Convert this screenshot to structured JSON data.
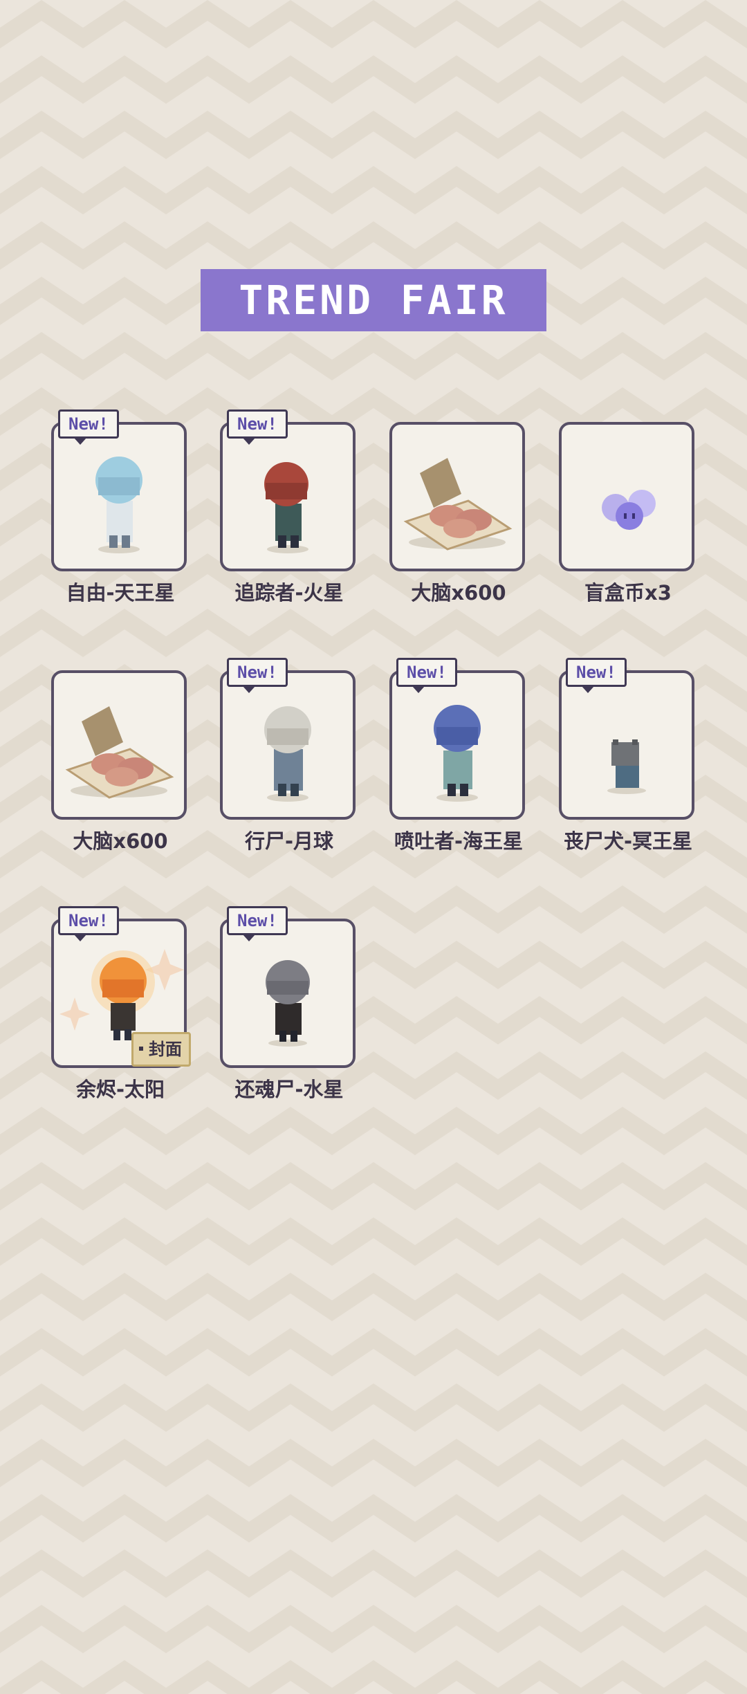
{
  "title": "TREND FAIR",
  "badge_text": "New!",
  "items": [
    {
      "label": "自由-天王星",
      "new": true,
      "art": "character-pale-blue-icon"
    },
    {
      "label": "追踪者-火星",
      "new": true,
      "art": "character-red-hair-icon"
    },
    {
      "label": "大脑x600",
      "new": false,
      "art": "brain-box-icon"
    },
    {
      "label": "盲盒币x3",
      "new": false,
      "art": "blind-box-coin-icon"
    },
    {
      "label": "大脑x600",
      "new": false,
      "art": "brain-box-icon"
    },
    {
      "label": "行尸-月球",
      "new": true,
      "art": "character-grey-hair-icon"
    },
    {
      "label": "喷吐者-海王星",
      "new": true,
      "art": "character-blue-hair-icon"
    },
    {
      "label": "丧尸犬-冥王星",
      "new": true,
      "art": "zombie-dog-icon"
    },
    {
      "label": "余烬-太阳",
      "new": true,
      "art": "character-fire-icon",
      "tag": "封面"
    },
    {
      "label": "还魂尸-水星",
      "new": true,
      "art": "character-dark-hair-icon"
    }
  ],
  "colors": {
    "accent": "#8a76cd",
    "border": "#574f66",
    "badge_text": "#5c4ea8"
  }
}
